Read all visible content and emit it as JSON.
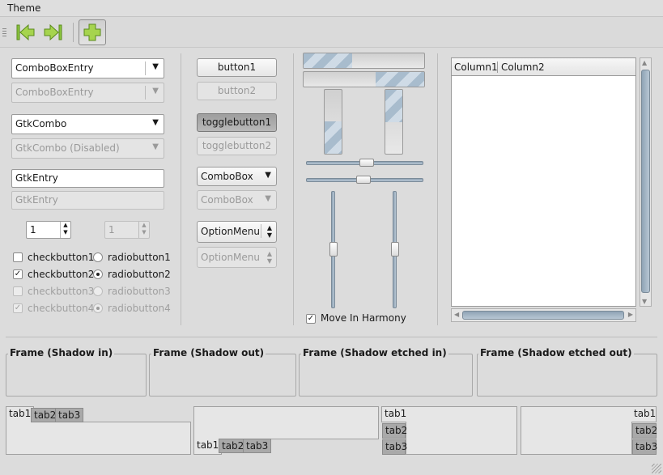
{
  "menu": {
    "theme": "Theme"
  },
  "toolbar": {
    "back_icon": "go-first-icon",
    "forward_icon": "go-last-icon",
    "add_icon": "add-icon"
  },
  "col1": {
    "combo_entry": "ComboBoxEntry",
    "combo_entry_dis": "ComboBoxEntry",
    "gtk_combo": "GtkCombo",
    "gtk_combo_dis": "GtkCombo (Disabled)",
    "entry": "GtkEntry",
    "entry_dis": "GtkEntry",
    "spin": "1",
    "spin_dis": "1",
    "check1": "checkbutton1",
    "check2": "checkbutton2",
    "check3": "checkbutton3",
    "check4": "checkbutton4",
    "radio1": "radiobutton1",
    "radio2": "radiobutton2",
    "radio3": "radiobutton3",
    "radio4": "radiobutton4"
  },
  "col2": {
    "button1": "button1",
    "button2": "button2",
    "toggle1": "togglebutton1",
    "toggle2": "togglebutton2",
    "combobox": "ComboBox",
    "combobox_dis": "ComboBox",
    "option": "OptionMenu",
    "option_dis": "OptionMenu"
  },
  "col3": {
    "progress_h1": 0.4,
    "progress_h2": 0.4,
    "progress_v1": 0.5,
    "progress_v2": 0.5,
    "harmony": "Move In Harmony"
  },
  "tree": {
    "col1": "Column1",
    "col2": "Column2"
  },
  "frames": {
    "in": "Frame (Shadow in)",
    "out": "Frame (Shadow out)",
    "etched_in": "Frame (Shadow etched in)",
    "etched_out": "Frame (Shadow etched out)"
  },
  "tabs": {
    "t1": "tab1",
    "t2": "tab2",
    "t3": "tab3"
  },
  "colors": {
    "accent": "#a8bccd",
    "toolbar_icon": "#9fcf3f"
  }
}
